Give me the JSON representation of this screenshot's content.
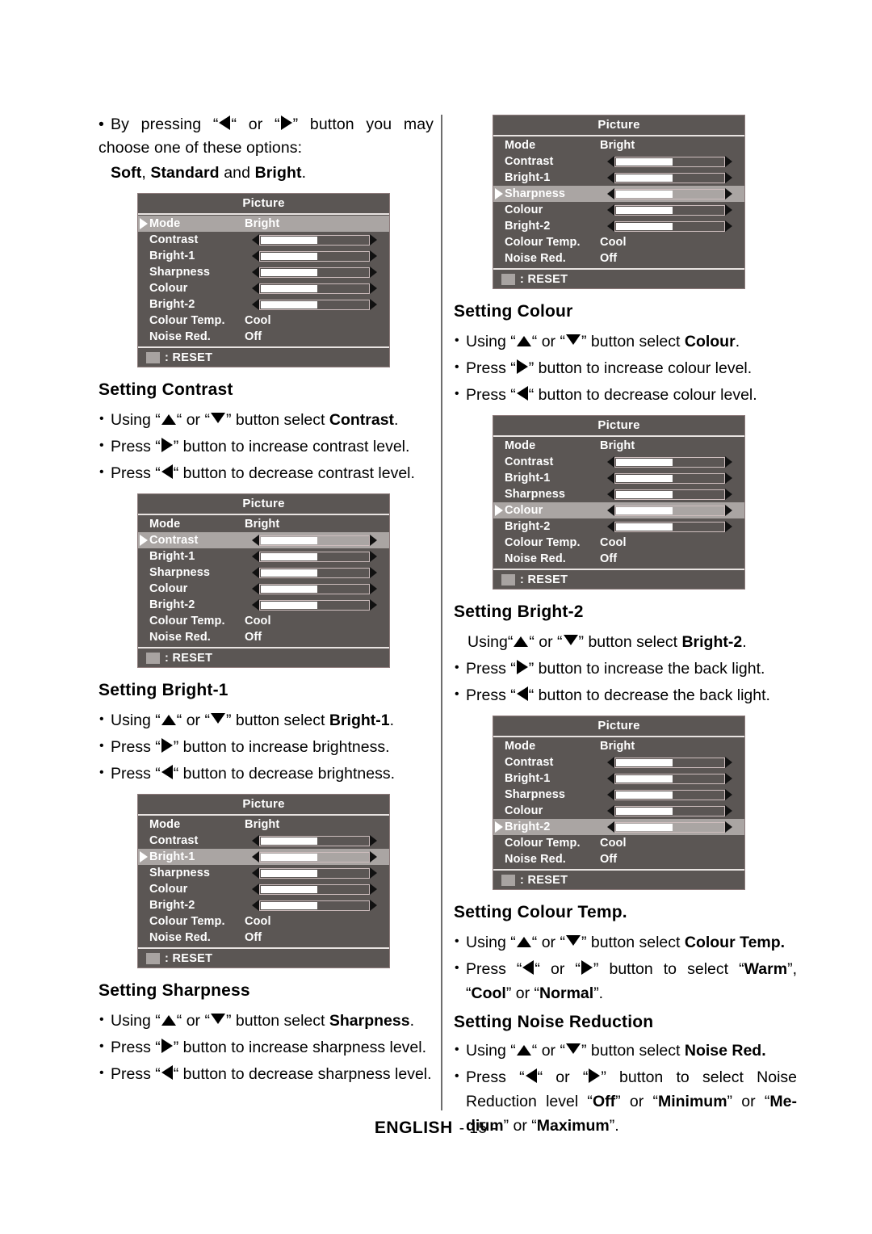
{
  "page": {
    "footer_language": "ENGLISH",
    "footer_page": "- 15 -"
  },
  "osd": {
    "title": "Picture",
    "reset_label": ": RESET",
    "rows": [
      {
        "label": "Mode",
        "type": "value",
        "value": "Bright"
      },
      {
        "label": "Contrast",
        "type": "slider",
        "fill_percent": 52
      },
      {
        "label": "Bright-1",
        "type": "slider",
        "fill_percent": 52
      },
      {
        "label": "Sharpness",
        "type": "slider",
        "fill_percent": 52
      },
      {
        "label": "Colour",
        "type": "slider",
        "fill_percent": 52
      },
      {
        "label": "Bright-2",
        "type": "slider",
        "fill_percent": 52
      },
      {
        "label": "Colour Temp.",
        "type": "value",
        "value": "Cool"
      },
      {
        "label": "Noise Red.",
        "type": "value",
        "value": "Off"
      }
    ],
    "selected": {
      "menu_mode": "Mode",
      "menu_contrast": "Contrast",
      "menu_bright1": "Bright-1",
      "menu_sharpness": "Sharpness",
      "menu_colour": "Colour",
      "menu_bright2": "Bright-2"
    }
  },
  "left_column": {
    "intro": {
      "line1_a": "By pressing “",
      "line1_b": "“ or “",
      "line1_c": "” button you may choose one of these options:",
      "options_soft": "Soft",
      "options_comma": ", ",
      "options_standard": "Standard",
      "options_and": " and ",
      "options_bright": "Bright",
      "options_period": "."
    },
    "contrast": {
      "heading": "Setting  Contrast",
      "b1_a": "Using “",
      "b1_b": "“ or “",
      "b1_c": "” button select ",
      "b1_bold": "Contrast",
      "b1_d": ".",
      "b2_a": "Press “",
      "b2_b": "” button to increase contrast level.",
      "b3_a": "Press “",
      "b3_b": "“  button to decrease contrast level."
    },
    "bright1": {
      "heading": "Setting Bright-1",
      "b1_a": "Using “",
      "b1_b": "“ or “",
      "b1_c": "” button select ",
      "b1_bold": "Bright-1",
      "b1_d": ".",
      "b2_a": "Press “",
      "b2_b": "” button to increase brightness.",
      "b3_a": "Press “",
      "b3_b": "“ button  to decrease brightness."
    },
    "sharpness": {
      "heading": "Setting Sharpness",
      "b1_a": "Using “",
      "b1_b": "“ or “",
      "b1_c": "” button select ",
      "b1_bold": "Sharpness",
      "b1_d": ".",
      "b2_a": "Press “",
      "b2_b": "” button to increase sharpness level.",
      "b3_a": "Press “",
      "b3_b": "“ button to decrease sharpness level."
    }
  },
  "right_column": {
    "colour": {
      "heading": "Setting Colour",
      "b1_a": "Using “",
      "b1_b": "“ or “",
      "b1_c": "” button select ",
      "b1_bold": "Colour",
      "b1_d": ".",
      "b2_a": "Press “",
      "b2_b": "” button to increase colour level.",
      "b3_a": "Press “",
      "b3_b": "“ button to decrease colour level."
    },
    "bright2": {
      "heading": "Setting Bright-2",
      "b1_a": "Using“",
      "b1_b": "“ or “",
      "b1_c": "” button select ",
      "b1_bold": "Bright-2",
      "b1_d": ".",
      "b2_a": "Press “",
      "b2_b": "” button to increase the back light.",
      "b3_a": "Press “",
      "b3_b": "“ button to decrease the back light."
    },
    "colour_temp": {
      "heading": "Setting Colour Temp.",
      "b1_a": "Using “",
      "b1_b": "“ or “",
      "b1_c": "” button select ",
      "b1_bold": "Colour Temp.",
      "b2_a": "Press “",
      "b2_b": "“ or “",
      "b2_c": "”  button to select “",
      "b2_warm": "Warm",
      "b2_d": "”, “",
      "b2_cool": "Cool",
      "b2_e": "” or “",
      "b2_normal": "Normal",
      "b2_f": "”."
    },
    "noise_reduction": {
      "heading": "Setting Noise Reduction",
      "b1_a": "Using “",
      "b1_b": "“ or “",
      "b1_c": "” button select ",
      "b1_bold": "Noise Red.",
      "b2_a": "Press “",
      "b2_b": "“ or “",
      "b2_c": "”  button to select Noise Reduction level “",
      "b2_off": "Off",
      "b2_d": "” or “",
      "b2_minimum": "Minimum",
      "b2_e": "” or “",
      "b2_medium": "Me-dium",
      "b2_f": "” or “",
      "b2_maximum": "Maximum",
      "b2_g": "”."
    }
  }
}
